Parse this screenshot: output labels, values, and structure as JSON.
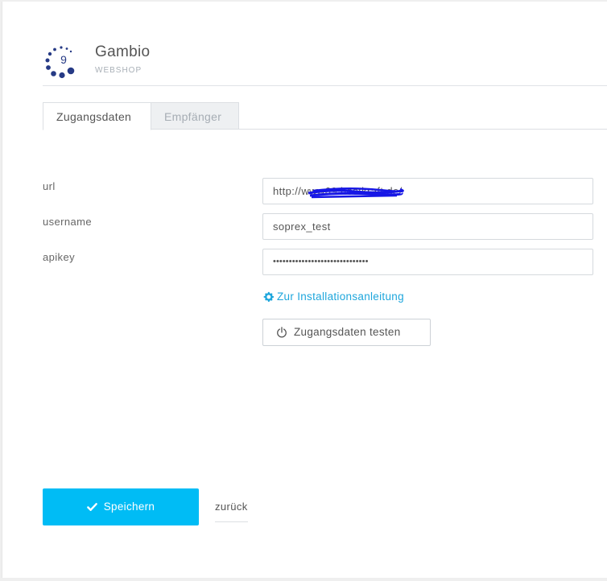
{
  "brand": {
    "title": "Gambio",
    "subtitle": "WEBSHOP",
    "logo_letter": "9",
    "logo_color": "#263a85"
  },
  "tabs": [
    {
      "label": "Zugangsdaten",
      "active": true
    },
    {
      "label": "Empfänger",
      "active": false
    }
  ],
  "form": {
    "url": {
      "label": "url",
      "value": "http://www69.hostkraft.de/"
    },
    "username": {
      "label": "username",
      "value": "soprex_test"
    },
    "apikey": {
      "label": "apikey",
      "value": "••••••••••••••••••••••••••••••"
    }
  },
  "install_link": {
    "label": "Zur Installationsanleitung",
    "icon": "gear-icon",
    "color": "#1ea6dc"
  },
  "test_button": {
    "label": "Zugangsdaten testen",
    "icon": "power-icon"
  },
  "save_button": {
    "label": "Speichern",
    "icon": "check-icon",
    "color": "#00bcf5"
  },
  "back_link": {
    "label": "zurück"
  }
}
